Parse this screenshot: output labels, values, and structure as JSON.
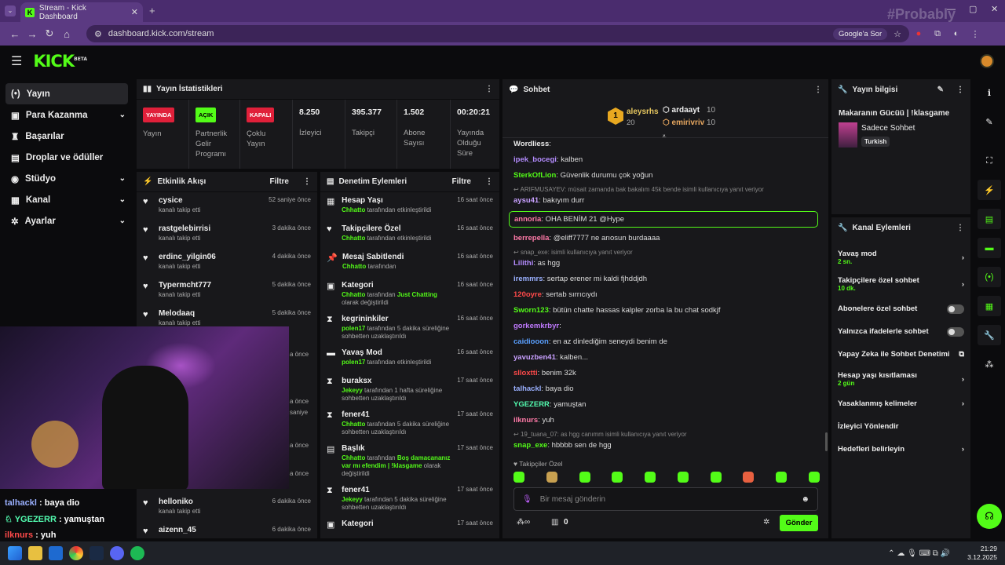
{
  "browser": {
    "tab_title": "Stream - Kick Dashboard",
    "url": "dashboard.kick.com/stream",
    "search_chip": "Google'a Sor",
    "watermark": "#Probably"
  },
  "sidebar": {
    "items": [
      {
        "label": "Yayın",
        "icon": "broadcast-icon"
      },
      {
        "label": "Para Kazanma",
        "icon": "money-icon"
      },
      {
        "label": "Başarılar",
        "icon": "trophy-icon"
      },
      {
        "label": "Droplar ve ödüller",
        "icon": "gift-icon"
      },
      {
        "label": "Stüdyo",
        "icon": "studio-icon"
      },
      {
        "label": "Kanal",
        "icon": "channel-icon"
      },
      {
        "label": "Ayarlar",
        "icon": "gear-icon"
      }
    ]
  },
  "stats": {
    "title": "Yayın İstatistikleri",
    "cols": [
      {
        "badge": "YAYINDA",
        "label": "Yayın"
      },
      {
        "badge": "AÇIK",
        "label": "Partnerlik Gelir Programı"
      },
      {
        "badge": "KAPALI",
        "label": "Çoklu Yayın"
      },
      {
        "value": "8.250",
        "label": "İzleyici"
      },
      {
        "value": "395.377",
        "label": "Takipçi"
      },
      {
        "value": "1.502",
        "label": "Abone Sayısı"
      },
      {
        "value": "00:20:21",
        "label": "Yayında Olduğu Süre"
      }
    ]
  },
  "activity": {
    "title": "Etkinlik Akışı",
    "filter": "Filtre",
    "rows": [
      {
        "user": "cysice",
        "desc": "kanalı takip etti",
        "time": "52 saniye önce"
      },
      {
        "user": "rastgelebirrisi",
        "desc": "kanalı takip etti",
        "time": "3 dakika önce"
      },
      {
        "user": "erdinc_yilgin06",
        "desc": "kanalı takip etti",
        "time": "4 dakika önce"
      },
      {
        "user": "Typermcht777",
        "desc": "kanalı takip etti",
        "time": "5 dakika önce"
      },
      {
        "user": "Melodaaq",
        "desc": "kanalı takip etti",
        "time": "5 dakika önce"
      },
      {
        "user": "helloniko",
        "desc": "kanalı takip etti",
        "time": "6 dakika önce"
      },
      {
        "user": "aizenn_45",
        "desc": "",
        "time": "6 dakika önce"
      }
    ],
    "partial_times": [
      "a önce",
      "a önce",
      "saniye",
      "a önce",
      "a önce"
    ]
  },
  "moderation": {
    "title": "Denetim Eylemleri",
    "filter": "Filtre",
    "rows": [
      {
        "title": "Hesap Yaşı",
        "actor": "Chhatto",
        "desc": " tarafından etkinleştirildi",
        "time": "16 saat önce",
        "icon": "calendar-icon"
      },
      {
        "title": "Takipçilere Özel",
        "actor": "Chhatto",
        "desc": " tarafından etkinleştirildi",
        "time": "16 saat önce",
        "icon": "heart-icon"
      },
      {
        "title": "Mesaj Sabitlendi",
        "actor": "Chhatto",
        "desc": " tarafından",
        "time": "16 saat önce",
        "icon": "pin-icon"
      },
      {
        "title": "Kategori",
        "actor": "Chhatto",
        "desc": " tarafından ",
        "extra": "Just Chatting",
        "desc2": " olarak değiştirildi",
        "time": "16 saat önce",
        "icon": "category-icon"
      },
      {
        "title": "kegrininkiler",
        "actor": "polen17",
        "desc": " tarafından 5 dakika süreliğine sohbetten uzaklaştırıldı",
        "time": "16 saat önce",
        "icon": "hourglass-icon"
      },
      {
        "title": "Yavaş Mod",
        "actor": "polen17",
        "desc": " tarafından etkinleştirildi",
        "time": "16 saat önce",
        "icon": "chat-icon"
      },
      {
        "title": "buraksx",
        "actor": "Jekeyy",
        "desc": " tarafından 1 hafta süreliğine sohbetten uzaklaştırıldı",
        "time": "17 saat önce",
        "icon": "hourglass-icon"
      },
      {
        "title": "fener41",
        "actor": "Chhatto",
        "desc": " tarafından 5 dakika süreliğine sohbetten uzaklaştırıldı",
        "time": "17 saat önce",
        "icon": "hourglass-icon"
      },
      {
        "title": "Başlık",
        "actor": "Chhatto",
        "desc": " tarafından ",
        "extra": "Boş damacananız var mı efendim | !klasgame",
        "desc2": " olarak değiştirildi",
        "time": "17 saat önce",
        "icon": "title-icon"
      },
      {
        "title": "fener41",
        "actor": "Jekeyy",
        "desc": " tarafından 5 dakika süreliğine sohbetten uzaklaştırıldı",
        "time": "17 saat önce",
        "icon": "hourglass-icon"
      },
      {
        "title": "Kategori",
        "actor": "",
        "desc": "",
        "time": "17 saat önce",
        "icon": "category-icon"
      }
    ]
  },
  "chat": {
    "title": "Sohbet",
    "leaders": [
      {
        "rank": "1",
        "name": "aleysrhs",
        "count": "20"
      },
      {
        "name": "ardaayt",
        "count": "10"
      },
      {
        "name": "emirivriv",
        "count": "10"
      }
    ],
    "messages": [
      {
        "user": "Wordliess",
        "text": "",
        "color": "#e8e8e8"
      },
      {
        "user": "ipek_bocegi",
        "text": "kalben",
        "color": "#b48cff"
      },
      {
        "user": "SterkOfLion",
        "text": "Güvenlik durumu çok yoğun",
        "color": "#53fc18"
      },
      {
        "reply": "ARIFMUSAYEV: müsait zamanda bak bakalım 45k bende isimli kullanıcıya yanıt veriyor"
      },
      {
        "user": "aysu41",
        "text": "bakıyım durr",
        "color": "#c8a0ff"
      },
      {
        "user": "annoria",
        "text": "OHA BENİM 21 @Hype",
        "color": "#ff7aa8",
        "highlight": true
      },
      {
        "user": "berrepella",
        "text": "@eliff7777 ne arıosun burdaaaa",
        "color": "#ff7aa8"
      },
      {
        "reply": "snap_exe: isimli kullanıcıya yanıt veriyor"
      },
      {
        "user": "Lilithi",
        "text": "as hgg",
        "color": "#b48cff"
      },
      {
        "user": "iremmrs",
        "text": "sertap erener mi kaldi fjhddjdh",
        "color": "#9ab0ff"
      },
      {
        "user": "120oyre",
        "text": "sertab sırrıcıydı",
        "color": "#ff4a4a"
      },
      {
        "user": "Sworn123",
        "text": "bütün chatte hassas kalpler zorba la bu chat sodkjf",
        "color": "#53fc18"
      },
      {
        "user": "gorkemkrbyr",
        "text": "",
        "color": "#c07aff"
      },
      {
        "user": "caidiooon",
        "text": "en az dinlediğim seneydi benim de",
        "color": "#5aa0ff"
      },
      {
        "user": "yavuzben41",
        "text": "kalben...",
        "color": "#c8a0ff"
      },
      {
        "user": "slloxtti",
        "text": "benim 32k",
        "color": "#ff4a4a"
      },
      {
        "user": "talhackl",
        "text": "baya dio",
        "color": "#9ab0ff"
      },
      {
        "user": "YGEZERR",
        "text": "yamuştan",
        "color": "#53fcb0"
      },
      {
        "user": "ilknurs",
        "text": "yuh",
        "color": "#ff7aa8"
      },
      {
        "reply": "19_tuana_07: as hgg canımm isimli kullanıcıya yanıt veriyor"
      },
      {
        "user": "snap_exe",
        "text": "hbbbb sen de hgg",
        "color": "#53fc18"
      }
    ],
    "followers_only": "Takipçiler Özel",
    "input_placeholder": "Bir mesaj gönderin",
    "points": "0",
    "send": "Gönder"
  },
  "stream_info": {
    "title": "Yayın bilgisi",
    "stream_title": "Makaranın Gücüü | !klasgame",
    "category": "Sadece Sohbet",
    "language": "Turkish"
  },
  "channel_actions": {
    "title": "Kanal Eylemleri",
    "rows": [
      {
        "label": "Yavaş mod",
        "sub": "2 sn.",
        "type": "chevron"
      },
      {
        "label": "Takipçilere özel sohbet",
        "sub": "10 dk.",
        "type": "chevron"
      },
      {
        "label": "Abonelere özel sohbet",
        "type": "toggle"
      },
      {
        "label": "Yalnızca ifadelerle sohbet",
        "type": "toggle"
      },
      {
        "label": "Yapay Zeka ile Sohbet Denetimi",
        "type": "external"
      },
      {
        "label": "Hesap yaşı kısıtlaması",
        "sub": "2 gün",
        "type": "chevron"
      },
      {
        "label": "Yasaklanmış kelimeler",
        "type": "chevron"
      },
      {
        "label": "İzleyici Yönlendir",
        "type": "none"
      },
      {
        "label": "Hedefleri belirleyin",
        "type": "chevron"
      }
    ]
  },
  "overlay_chat": [
    {
      "user": "talhackl",
      "text": " : baya dio",
      "color": "#9ab0ff"
    },
    {
      "user": "YGEZERR",
      "text": " : yamuştan",
      "color": "#53fcb0"
    },
    {
      "user": "ilknurs",
      "text": " : yuh",
      "color": "#ff4a4a"
    }
  ],
  "taskbar": {
    "time": "21:29",
    "date": "3.12.2025"
  },
  "colors": {
    "accent": "#53fc18",
    "panel": "#18181b",
    "bg": "#0b0b0d"
  }
}
